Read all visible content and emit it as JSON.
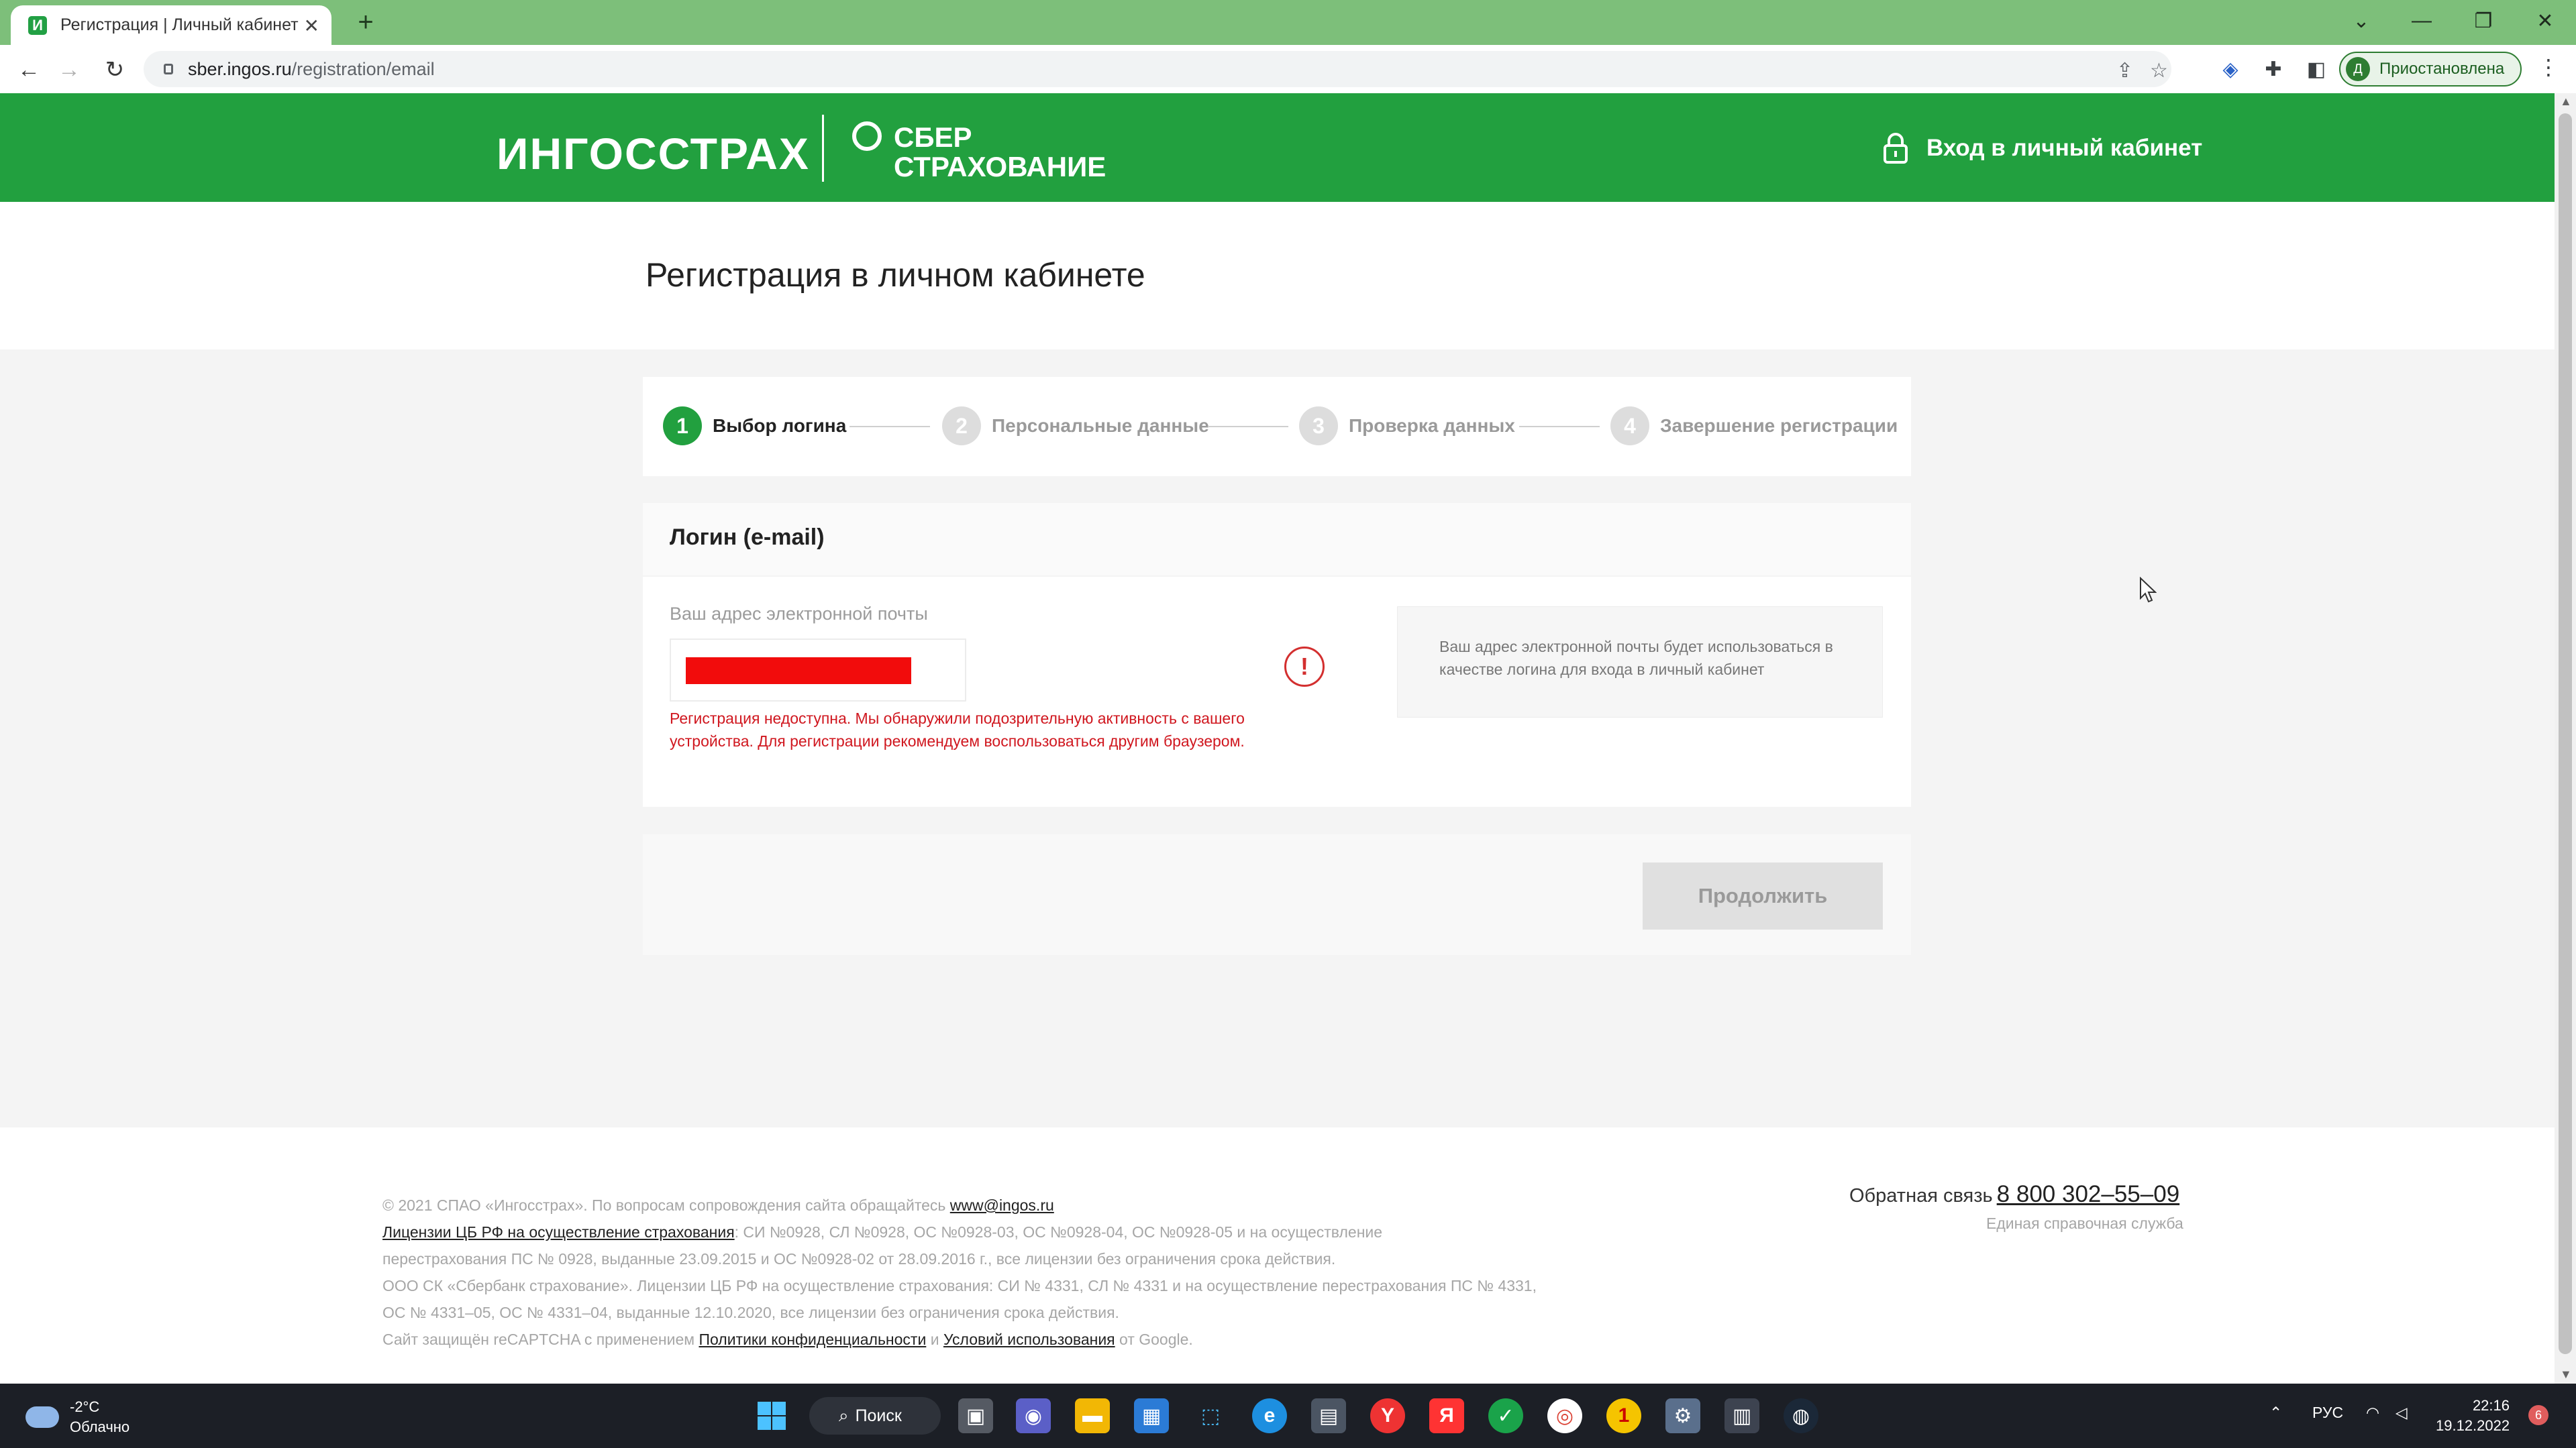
{
  "browser": {
    "tab_title": "Регистрация | Личный кабинет",
    "tab_favicon_letter": "И",
    "url_host": "sber.ingos.ru",
    "url_path": "/registration/email",
    "profile_initial": "Д",
    "profile_label": "Приостановлена"
  },
  "header": {
    "logo_ingos": "ИНГОССТРАХ",
    "logo_sber_line1": "СБЕР",
    "logo_sber_line2": "СТРАХОВАНИЕ",
    "login_link": "Вход в личный кабинет",
    "brand_color": "#22a03f"
  },
  "page": {
    "title": "Регистрация в личном кабинете"
  },
  "steps": [
    {
      "num": "1",
      "label": "Выбор логина",
      "active": true
    },
    {
      "num": "2",
      "label": "Персональные данные",
      "active": false
    },
    {
      "num": "3",
      "label": "Проверка данных",
      "active": false
    },
    {
      "num": "4",
      "label": "Завершение регистрации",
      "active": false
    }
  ],
  "form": {
    "section_title": "Логин (e-mail)",
    "email_label": "Ваш адрес электронной почты",
    "error_icon": "!",
    "error_message": "Регистрация недоступна. Мы обнаружили подозрительную активность с вашего устройства. Для регистрации рекомендуем воспользоваться другим браузером.",
    "hint": "Ваш адрес электронной почты будет использоваться в качестве логина для входа в личный кабинет",
    "continue_label": "Продолжить",
    "error_color": "#d0171f"
  },
  "footer": {
    "copyright": "© 2021 СПАО «Ингосстрах». По вопросам сопровождения сайта обращайтесь",
    "site_link": "www@ingos.ru",
    "licenses_link": "Лицензии ЦБ РФ на осуществление страхования",
    "licenses_text_1": ": СИ №0928, СЛ №0928, ОС №0928-03, ОС №0928-04, ОС №0928-05 и на осуществление",
    "licenses_text_2": "перестрахования ПС № 0928, выданные 23.09.2015 и ОС №0928-02 от 28.09.2016 г., все лицензии без ограничения срока действия.",
    "sber_text_1": "ООО СК «Сбербанк страхование». Лицензии ЦБ РФ на осуществление страхования: СИ № 4331, СЛ № 4331 и на осуществление перестрахования ПС № 4331,",
    "sber_text_2": "ОС № 4331–05, ОС № 4331–04, выданные 12.10.2020, все лицензии без ограничения срока действия.",
    "recaptcha_prefix": "Сайт защищён reCAPTCHA с применением",
    "privacy_link": "Политики конфиденциальности",
    "and": "и",
    "terms_link": "Условий использования",
    "recaptcha_suffix": "от Google.",
    "feedback_label": "Обратная связь",
    "phone": "8 800 302–55–09",
    "phone_sub": "Единая справочная служба"
  },
  "taskbar": {
    "temperature": "-2°C",
    "weather": "Облачно",
    "search_label": "Поиск",
    "language": "РУС",
    "time": "22:16",
    "date": "19.12.2022",
    "notifications": "6"
  }
}
